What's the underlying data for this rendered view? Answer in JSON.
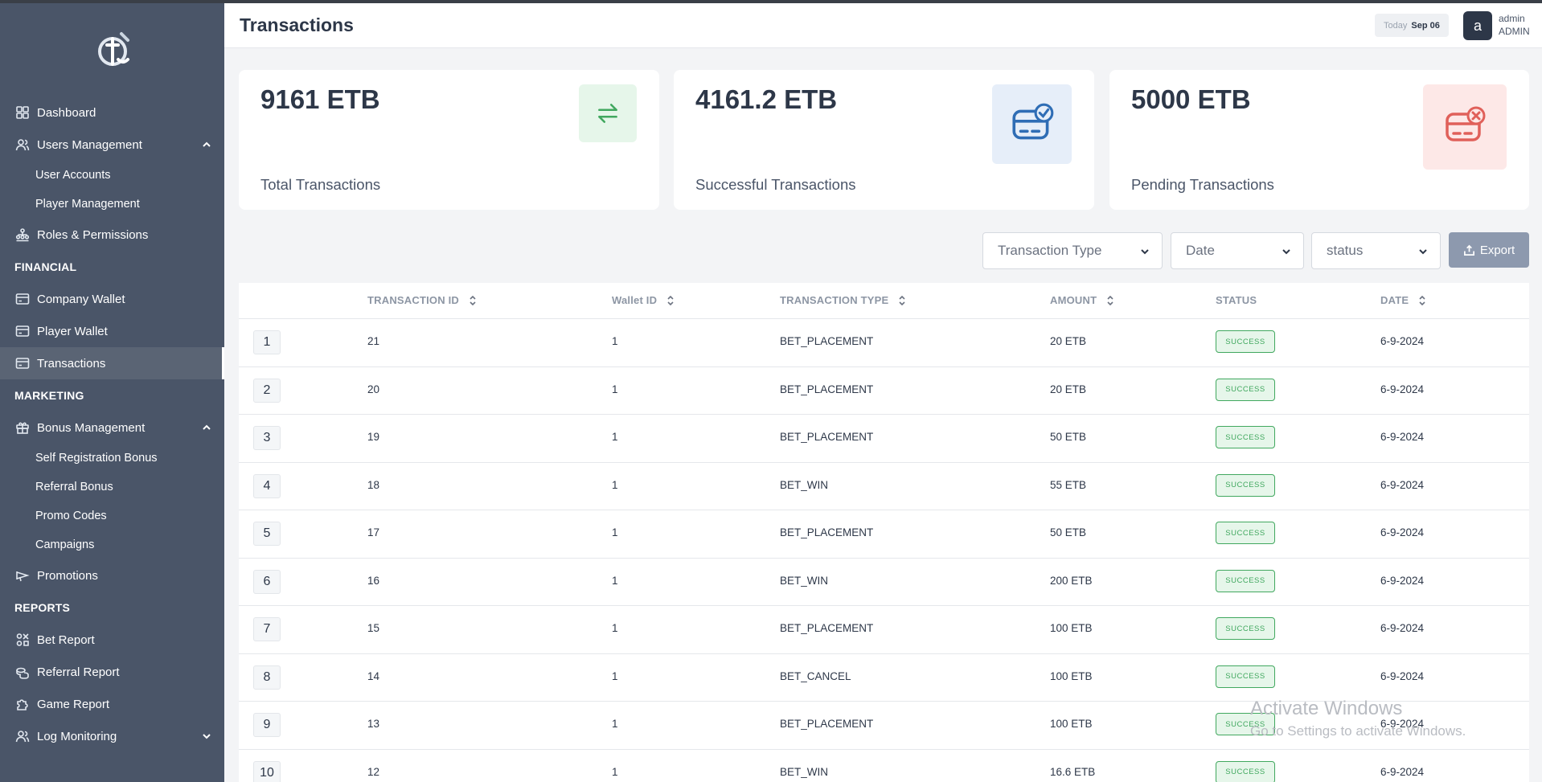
{
  "header": {
    "title": "Transactions",
    "today_label": "Today",
    "today_value": "Sep 06",
    "avatar_letter": "a",
    "user_name": "admin",
    "user_role": "ADMIN"
  },
  "sidebar": {
    "items": [
      {
        "type": "item",
        "label": "Dashboard",
        "icon": "grid-icon"
      },
      {
        "type": "item",
        "label": "Users Management",
        "icon": "users-icon",
        "chevron": "up"
      },
      {
        "type": "sub",
        "label": "User Accounts"
      },
      {
        "type": "sub",
        "label": "Player Management"
      },
      {
        "type": "item",
        "label": "Roles & Permissions",
        "icon": "hierarchy-icon"
      },
      {
        "type": "section",
        "label": "FINANCIAL"
      },
      {
        "type": "item",
        "label": "Company Wallet",
        "icon": "wallet-icon"
      },
      {
        "type": "item",
        "label": "Player Wallet",
        "icon": "wallet-icon"
      },
      {
        "type": "item",
        "label": "Transactions",
        "icon": "wallet-icon",
        "active": true
      },
      {
        "type": "section",
        "label": "MARKETING"
      },
      {
        "type": "item",
        "label": "Bonus Management",
        "icon": "gift-icon",
        "chevron": "up"
      },
      {
        "type": "sub",
        "label": "Self Registration Bonus"
      },
      {
        "type": "sub",
        "label": "Referral Bonus"
      },
      {
        "type": "sub",
        "label": "Promo Codes"
      },
      {
        "type": "sub",
        "label": "Campaigns"
      },
      {
        "type": "item",
        "label": "Promotions",
        "icon": "megaphone-icon"
      },
      {
        "type": "section",
        "label": "REPORTS"
      },
      {
        "type": "item",
        "label": "Bet Report",
        "icon": "bet-icon"
      },
      {
        "type": "item",
        "label": "Referral Report",
        "icon": "coins-icon"
      },
      {
        "type": "item",
        "label": "Game Report",
        "icon": "puzzle-icon"
      },
      {
        "type": "item",
        "label": "Log Monitoring",
        "icon": "users-icon",
        "chevron": "down"
      }
    ]
  },
  "stats": {
    "total": {
      "amount": "9161 ETB",
      "label": "Total Transactions"
    },
    "successful": {
      "amount": "4161.2 ETB",
      "label": "Successful Transactions"
    },
    "pending": {
      "amount": "5000 ETB",
      "label": "Pending Transactions"
    }
  },
  "filters": {
    "type_label": "Transaction Type",
    "date_label": "Date",
    "status_label": "status",
    "export_label": "Export"
  },
  "table": {
    "headers": [
      "TRANSACTION ID",
      "Wallet ID",
      "TRANSACTION TYPE",
      "AMOUNT",
      "STATUS",
      "DATE"
    ],
    "rows": [
      {
        "no": "1",
        "id": "21",
        "wallet": "1",
        "type": "BET_PLACEMENT",
        "amount": "20 ETB",
        "status": "SUCCESS",
        "date": "6-9-2024"
      },
      {
        "no": "2",
        "id": "20",
        "wallet": "1",
        "type": "BET_PLACEMENT",
        "amount": "20 ETB",
        "status": "SUCCESS",
        "date": "6-9-2024"
      },
      {
        "no": "3",
        "id": "19",
        "wallet": "1",
        "type": "BET_PLACEMENT",
        "amount": "50 ETB",
        "status": "SUCCESS",
        "date": "6-9-2024"
      },
      {
        "no": "4",
        "id": "18",
        "wallet": "1",
        "type": "BET_WIN",
        "amount": "55 ETB",
        "status": "SUCCESS",
        "date": "6-9-2024"
      },
      {
        "no": "5",
        "id": "17",
        "wallet": "1",
        "type": "BET_PLACEMENT",
        "amount": "50 ETB",
        "status": "SUCCESS",
        "date": "6-9-2024"
      },
      {
        "no": "6",
        "id": "16",
        "wallet": "1",
        "type": "BET_WIN",
        "amount": "200 ETB",
        "status": "SUCCESS",
        "date": "6-9-2024"
      },
      {
        "no": "7",
        "id": "15",
        "wallet": "1",
        "type": "BET_PLACEMENT",
        "amount": "100 ETB",
        "status": "SUCCESS",
        "date": "6-9-2024"
      },
      {
        "no": "8",
        "id": "14",
        "wallet": "1",
        "type": "BET_CANCEL",
        "amount": "100 ETB",
        "status": "SUCCESS",
        "date": "6-9-2024"
      },
      {
        "no": "9",
        "id": "13",
        "wallet": "1",
        "type": "BET_PLACEMENT",
        "amount": "100 ETB",
        "status": "SUCCESS",
        "date": "6-9-2024"
      },
      {
        "no": "10",
        "id": "12",
        "wallet": "1",
        "type": "BET_WIN",
        "amount": "16.6 ETB",
        "status": "SUCCESS",
        "date": "6-9-2024"
      }
    ]
  },
  "watermark": {
    "line1": "Activate Windows",
    "line2": "Go to Settings to activate Windows."
  },
  "colors": {
    "sidebar": "#4a5568",
    "success": "#41a85f",
    "pending": "#e0605a",
    "info": "#2f6db5",
    "export": "#8d99ae"
  }
}
